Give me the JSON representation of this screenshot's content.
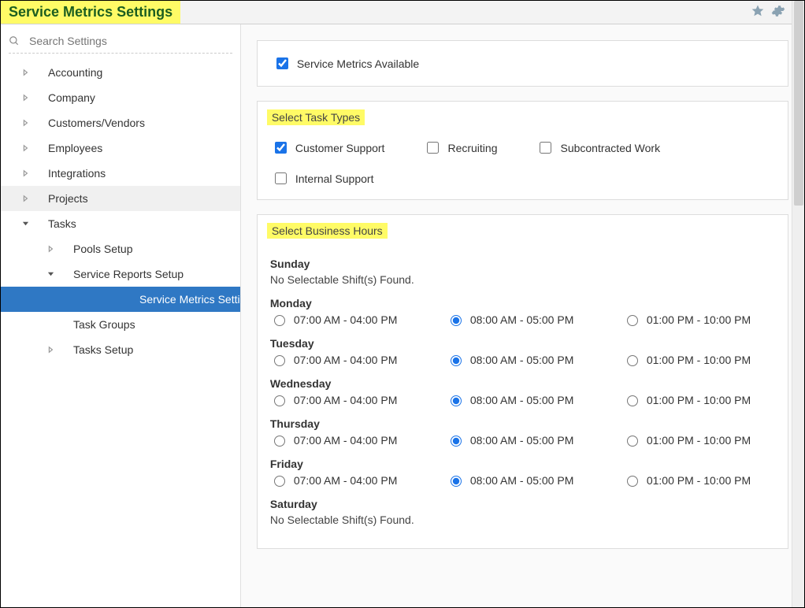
{
  "header": {
    "title": "Service Metrics Settings"
  },
  "search": {
    "placeholder": "Search Settings"
  },
  "sidebar": {
    "items": [
      {
        "label": "Accounting",
        "expandable": true,
        "depth": 0
      },
      {
        "label": "Company",
        "expandable": true,
        "depth": 0
      },
      {
        "label": "Customers/Vendors",
        "expandable": true,
        "depth": 0
      },
      {
        "label": "Employees",
        "expandable": true,
        "depth": 0
      },
      {
        "label": "Integrations",
        "expandable": true,
        "depth": 0
      },
      {
        "label": "Projects",
        "expandable": true,
        "depth": 0,
        "shaded": true
      },
      {
        "label": "Tasks",
        "expandable": true,
        "depth": 0,
        "expanded": true
      },
      {
        "label": "Pools Setup",
        "expandable": true,
        "depth": 1
      },
      {
        "label": "Service Reports Setup",
        "expandable": true,
        "depth": 1,
        "expanded": true
      },
      {
        "label": "Service Metrics Settings",
        "expandable": false,
        "depth": 2,
        "selected": true
      },
      {
        "label": "Task Groups",
        "expandable": false,
        "depth": 1
      },
      {
        "label": "Tasks Setup",
        "expandable": true,
        "depth": 1
      }
    ]
  },
  "available": {
    "label": "Service Metrics Available",
    "checked": true
  },
  "taskTypes": {
    "heading": "Select Task Types",
    "items": [
      {
        "label": "Customer Support",
        "checked": true
      },
      {
        "label": "Recruiting",
        "checked": false
      },
      {
        "label": "Subcontracted Work",
        "checked": false
      },
      {
        "label": "Internal Support",
        "checked": false
      }
    ]
  },
  "hours": {
    "heading": "Select Business Hours",
    "noShiftText": "No Selectable Shift(s) Found.",
    "days": [
      {
        "name": "Sunday",
        "shifts": []
      },
      {
        "name": "Monday",
        "shifts": [
          {
            "label": "07:00 AM - 04:00 PM",
            "selected": false
          },
          {
            "label": "08:00 AM - 05:00 PM",
            "selected": true
          },
          {
            "label": "01:00 PM - 10:00 PM",
            "selected": false
          }
        ]
      },
      {
        "name": "Tuesday",
        "shifts": [
          {
            "label": "07:00 AM - 04:00 PM",
            "selected": false
          },
          {
            "label": "08:00 AM - 05:00 PM",
            "selected": true
          },
          {
            "label": "01:00 PM - 10:00 PM",
            "selected": false
          }
        ]
      },
      {
        "name": "Wednesday",
        "shifts": [
          {
            "label": "07:00 AM - 04:00 PM",
            "selected": false
          },
          {
            "label": "08:00 AM - 05:00 PM",
            "selected": true
          },
          {
            "label": "01:00 PM - 10:00 PM",
            "selected": false
          }
        ]
      },
      {
        "name": "Thursday",
        "shifts": [
          {
            "label": "07:00 AM - 04:00 PM",
            "selected": false
          },
          {
            "label": "08:00 AM - 05:00 PM",
            "selected": true
          },
          {
            "label": "01:00 PM - 10:00 PM",
            "selected": false
          }
        ]
      },
      {
        "name": "Friday",
        "shifts": [
          {
            "label": "07:00 AM - 04:00 PM",
            "selected": false
          },
          {
            "label": "08:00 AM - 05:00 PM",
            "selected": true
          },
          {
            "label": "01:00 PM - 10:00 PM",
            "selected": false
          }
        ]
      },
      {
        "name": "Saturday",
        "shifts": []
      }
    ]
  }
}
